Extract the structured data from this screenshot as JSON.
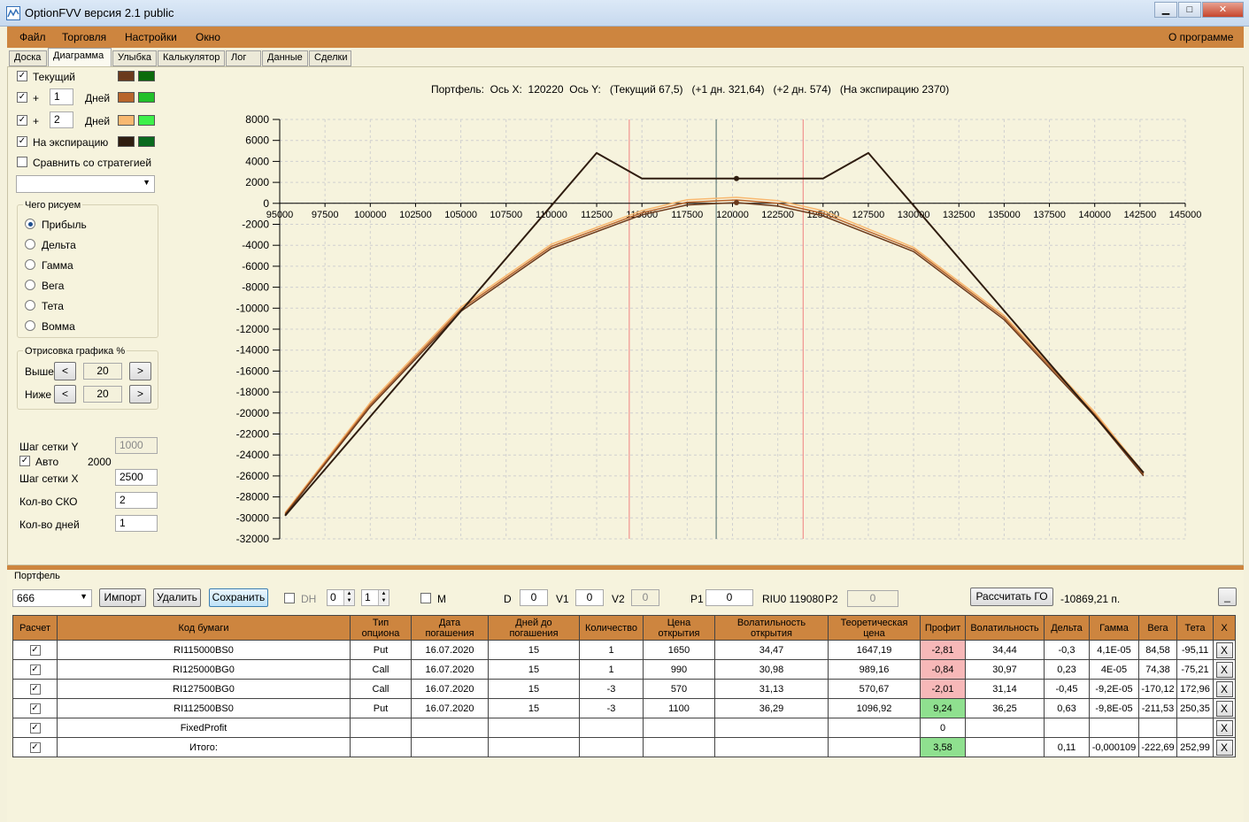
{
  "window": {
    "title": "OptionFVV версия 2.1 public",
    "minimize": "▁",
    "maximize": "□",
    "close": "✕"
  },
  "menu": {
    "items": [
      "Файл",
      "Торговля",
      "Настройки",
      "Окно"
    ],
    "about": "О программе"
  },
  "tabs": [
    "Доска",
    "Диаграмма",
    "Улыбка",
    "Калькулятор",
    "Лог",
    "Данные",
    "Сделки"
  ],
  "active_tab": 1,
  "left_panel": {
    "series_rows": [
      {
        "checked": true,
        "label": "Текущий",
        "plus": "",
        "days": "",
        "days_label": "",
        "color1": "#6b3a1c",
        "color2": "#0b6b0b"
      },
      {
        "checked": true,
        "label": "",
        "plus": "+",
        "days": "1",
        "days_label": "Дней",
        "color1": "#b8652c",
        "color2": "#22c02a"
      },
      {
        "checked": true,
        "label": "",
        "plus": "+",
        "days": "2",
        "days_label": "Дней",
        "color1": "#f8b870",
        "color2": "#3ef04a"
      },
      {
        "checked": true,
        "label": "На экспирацию",
        "plus": "",
        "days": "",
        "days_label": "",
        "color1": "#2f1d10",
        "color2": "#0a6a1e"
      }
    ],
    "compare_label": "Сравнить со стратегией",
    "compare_checked": false,
    "strategy_combo": "",
    "draw_group": {
      "title": "Чего рисуем",
      "options": [
        "Прибыль",
        "Дельта",
        "Гамма",
        "Вега",
        "Тета",
        "Вомма"
      ],
      "selected": 0
    },
    "percent_group": {
      "title": "Отрисовка графика %",
      "above_label": "Выше",
      "above_value": "20",
      "below_label": "Ниже",
      "below_value": "20",
      "dec": "<",
      "inc": ">"
    },
    "grid_y_label": "Шаг сетки Y",
    "grid_y_value": "1000",
    "auto_label": "Авто",
    "auto_checked": true,
    "auto_value": "2000",
    "grid_x_label": "Шаг сетки X",
    "grid_x_value": "2500",
    "sko_label": "Кол-во СКО",
    "sko_value": "2",
    "days_count_label": "Кол-во дней",
    "days_count_value": "1"
  },
  "chart_header": "Портфель:  Ось X:  120220  Ось Y:   (Текущий 67,5)   (+1 дн. 321,64)   (+2 дн. 574)   (На экспирацию 2370)",
  "chart_data": {
    "type": "line",
    "title": "Портфель:  Ось X:  120220  Ось Y:   (Текущий 67,5)   (+1 дн. 321,64)   (+2 дн. 574)   (На экспирацию 2370)",
    "x_ticks": [
      95000,
      97500,
      100000,
      102500,
      105000,
      107500,
      110000,
      112500,
      115000,
      117500,
      120000,
      122500,
      125000,
      127500,
      130000,
      132500,
      135000,
      137500,
      140000,
      142500,
      145000
    ],
    "y_ticks": [
      8000,
      6000,
      4000,
      2000,
      0,
      -2000,
      -4000,
      -6000,
      -8000,
      -10000,
      -12000,
      -14000,
      -16000,
      -18000,
      -20000,
      -22000,
      -24000,
      -26000,
      -28000,
      -30000,
      -32000
    ],
    "xlim": [
      95000,
      145000
    ],
    "ylim": [
      -32000,
      8000
    ],
    "grid": true,
    "vertical_lines": [
      {
        "x": 114300,
        "color": "#f08080"
      },
      {
        "x": 119100,
        "color": "#4a6b6b"
      },
      {
        "x": 123900,
        "color": "#f08080"
      }
    ],
    "series": [
      {
        "name": "На экспирацию",
        "color": "#2f1d10",
        "x": [
          95300,
          112500,
          115000,
          125000,
          127500,
          142700
        ],
        "y": [
          -29800,
          4800,
          2370,
          2370,
          4800,
          -25700
        ]
      },
      {
        "name": "Текущий",
        "color": "#6b3a1c",
        "x": [
          95300,
          100000,
          105000,
          110000,
          115000,
          117500,
          120220,
          122500,
          125000,
          130000,
          135000,
          140000,
          142700
        ],
        "y": [
          -29700,
          -19400,
          -10300,
          -4300,
          -1100,
          -150,
          67.5,
          -260,
          -1200,
          -4600,
          -11100,
          -20300,
          -26000
        ]
      },
      {
        "name": "+1 дн.",
        "color": "#b8652c",
        "x": [
          95300,
          100000,
          105000,
          110000,
          115000,
          117500,
          120220,
          122500,
          125000,
          130000,
          135000,
          140000,
          142700
        ],
        "y": [
          -29600,
          -19200,
          -10100,
          -4100,
          -900,
          100,
          321.64,
          0,
          -950,
          -4400,
          -10900,
          -20100,
          -25850
        ]
      },
      {
        "name": "+2 дн.",
        "color": "#f8b870",
        "x": [
          95300,
          100000,
          105000,
          110000,
          115000,
          117500,
          120220,
          122500,
          125000,
          130000,
          135000,
          140000,
          142700
        ],
        "y": [
          -29500,
          -19000,
          -9900,
          -3900,
          -700,
          350,
          574,
          250,
          -700,
          -4200,
          -10700,
          -19900,
          -25700
        ]
      }
    ],
    "markers": [
      {
        "x": 120220,
        "y": 2370,
        "color": "#2f1d10"
      },
      {
        "x": 120220,
        "y": 67.5,
        "color": "#6b3a1c"
      }
    ]
  },
  "portfolio": {
    "title": "Портфель",
    "name": "666",
    "import": "Импорт",
    "delete": "Удалить",
    "save": "Сохранить",
    "dh_label": "DH",
    "spin1": "0",
    "spin2": "1",
    "m_label": "M",
    "d_label": "D",
    "d_value": "0",
    "v1_label": "V1",
    "v1_value": "0",
    "v2_label": "V2",
    "v2_value": "0",
    "p1_label": "P1",
    "p1_value": "0",
    "riu_text": "RIU0 119080",
    "p2_label": "P2",
    "p2_value": "0",
    "calc_go": "Рассчитать ГО",
    "go_value": "-10869,21 п.",
    "collapse": "_"
  },
  "table": {
    "headers": [
      "Расчет",
      "Код бумаги",
      "Тип опциона",
      "Дата погашения",
      "Дней до погашения",
      "Количество",
      "Цена открытия",
      "Волатильность открытия",
      "Теоретическая цена",
      "Профит",
      "Волатильность",
      "Дельта",
      "Гамма",
      "Вега",
      "Тета",
      "X"
    ],
    "rows": [
      {
        "checked": true,
        "code": "RI115000BS0",
        "type": "Put",
        "date": "16.07.2020",
        "days": "15",
        "qty": "1",
        "price": "1650",
        "vol_open": "34,47",
        "theo": "1647,19",
        "profit": "-2,81",
        "profit_sign": "neg",
        "vol": "34,44",
        "delta": "-0,3",
        "gamma": "4,1E-05",
        "vega": "84,58",
        "theta": "-95,11",
        "x": "X"
      },
      {
        "checked": true,
        "code": "RI125000BG0",
        "type": "Call",
        "date": "16.07.2020",
        "days": "15",
        "qty": "1",
        "price": "990",
        "vol_open": "30,98",
        "theo": "989,16",
        "profit": "-0,84",
        "profit_sign": "neg",
        "vol": "30,97",
        "delta": "0,23",
        "gamma": "4E-05",
        "vega": "74,38",
        "theta": "-75,21",
        "x": "X"
      },
      {
        "checked": true,
        "code": "RI127500BG0",
        "type": "Call",
        "date": "16.07.2020",
        "days": "15",
        "qty": "-3",
        "price": "570",
        "vol_open": "31,13",
        "theo": "570,67",
        "profit": "-2,01",
        "profit_sign": "neg",
        "vol": "31,14",
        "delta": "-0,45",
        "gamma": "-9,2E-05",
        "vega": "-170,12",
        "theta": "172,96",
        "x": "X"
      },
      {
        "checked": true,
        "code": "RI112500BS0",
        "type": "Put",
        "date": "16.07.2020",
        "days": "15",
        "qty": "-3",
        "price": "1100",
        "vol_open": "36,29",
        "theo": "1096,92",
        "profit": "9,24",
        "profit_sign": "pos",
        "vol": "36,25",
        "delta": "0,63",
        "gamma": "-9,8E-05",
        "vega": "-211,53",
        "theta": "250,35",
        "x": "X"
      },
      {
        "checked": true,
        "code": "FixedProfit",
        "type": "",
        "date": "",
        "days": "",
        "qty": "",
        "price": "",
        "vol_open": "",
        "theo": "",
        "profit": "0",
        "profit_sign": "",
        "vol": "",
        "delta": "",
        "gamma": "",
        "vega": "",
        "theta": "",
        "x": "X"
      },
      {
        "checked": true,
        "code": "Итого:",
        "type": "",
        "date": "",
        "days": "",
        "qty": "",
        "price": "",
        "vol_open": "",
        "theo": "",
        "profit": "3,58",
        "profit_sign": "pos",
        "vol": "",
        "delta": "0,11",
        "gamma": "-0,000109",
        "vega": "-222,69",
        "theta": "252,99",
        "x": "X"
      }
    ]
  }
}
